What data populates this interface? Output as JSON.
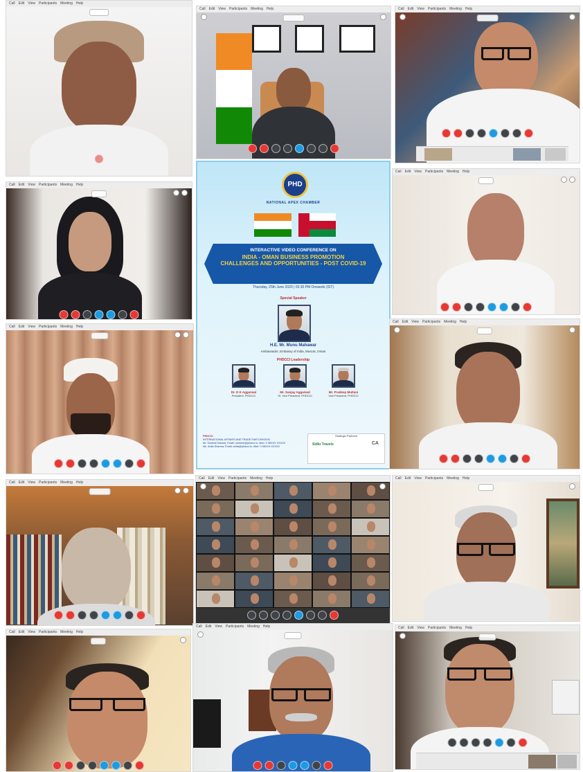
{
  "menu": [
    "Call",
    "Edit",
    "View",
    "Participants",
    "Meeting",
    "Help"
  ],
  "window_title": "Cisco Webex Meetings",
  "poster": {
    "org": "PHD",
    "org_sub": "CHAMBER",
    "chamber": "NATIONAL APEX CHAMBER",
    "line1": "INTERACTIVE VIDEO CONFERENCE ON",
    "line2": "INDIA - OMAN BUSINESS PROMOTION",
    "line3": "CHALLENGES AND OPPORTUNITIES - POST COVID-19",
    "date": "Thursday, 25th June 2020 | 03:30 PM Onwards (IST)",
    "special_speaker_label": "Special Speaker",
    "speaker_name": "H.E. Mr. Munu Mahawar",
    "speaker_role": "Ambassador, Embassy of India, Muscat, Oman",
    "leadership_label": "PHDCCI Leadership",
    "leaders": [
      {
        "name": "Dr. D K Aggarwal",
        "role": "President, PHDCCI"
      },
      {
        "name": "Mr. Sanjay Aggarwal",
        "role": "Sr. Vice President, PHDCCI"
      },
      {
        "name": "Mr. Pradeep Multani",
        "role": "Vice President, PHDCCI"
      }
    ],
    "footer_head": "PHDCCI",
    "footer_lines": [
      "INTERNATIONAL AFFAIRS AND TRADE FAIR DIVISION",
      "Mr. Somesh Basnet, Email: somesh@phdcci.in, Mob: 0 98XXX XXXXX",
      "Ms. Anita Sharma, Email: anita@phdcci.in, Mob: 0 98XXX XXXXX"
    ],
    "partners_label": "Strategic Partners",
    "partner_a": "Sidlu Travels",
    "partner_b": "CA"
  },
  "colors": {
    "end_call": "#e53935",
    "active": "#1e9be0",
    "control": "#404448",
    "poster_blue": "#1657a8"
  }
}
